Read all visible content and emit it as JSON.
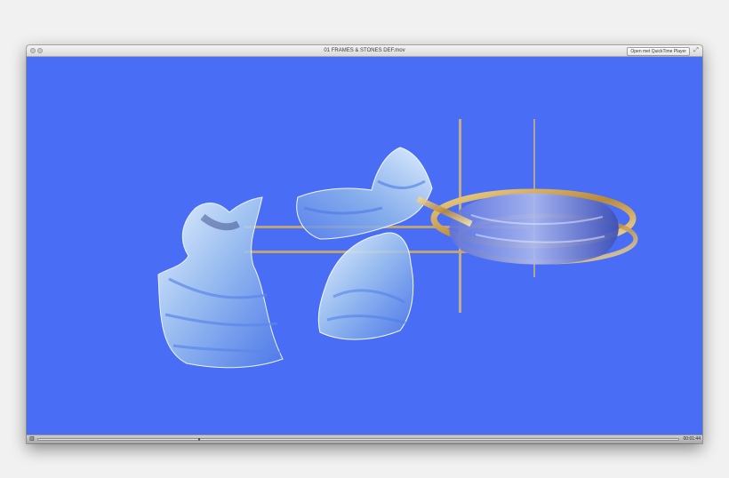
{
  "window": {
    "title": "01 FRAMES & STONES DEF.mov",
    "open_button_label": "Open met QuickTime Player",
    "timecode": "00:01:44"
  },
  "icons": {
    "close": "close-icon",
    "minimize": "minimize-icon",
    "fullscreen": "fullscreen-icon",
    "control": "volume-icon"
  },
  "colors": {
    "video_background": "#4a6df5",
    "frame_gold": "#d7b46a",
    "glass_light": "#d8ecff"
  }
}
